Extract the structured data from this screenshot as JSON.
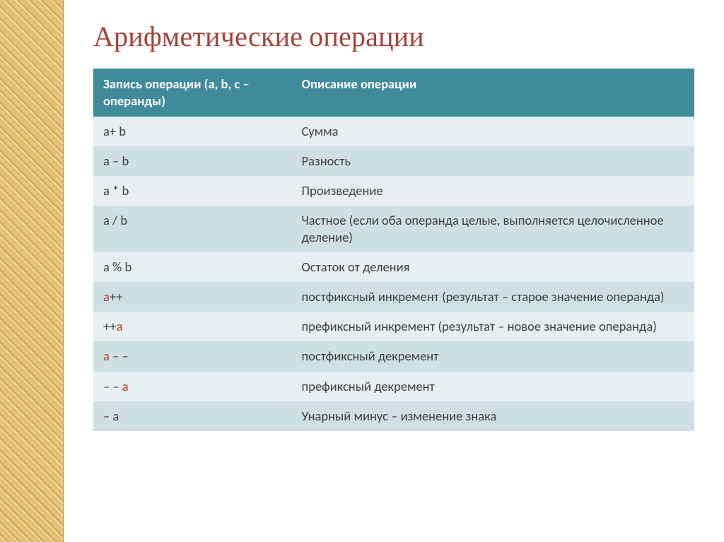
{
  "title": "Арифметические операции",
  "headers": {
    "col1": "Запись операции (a, b, c – операнды)",
    "col2": "Описание операции"
  },
  "rows": [
    {
      "op_plain": "a+ b",
      "desc": "Сумма"
    },
    {
      "op_plain": "a – b",
      "desc": "Разность"
    },
    {
      "op_plain": "a * b",
      "desc": "Произведение"
    },
    {
      "op_plain": "a / b",
      "desc": "Частное (если оба операнда целые, выполняется целочисленное деление)"
    },
    {
      "op_plain": "a % b",
      "desc": "Остаток от деления"
    },
    {
      "op_red_prefix": "a",
      "op_suffix": "++",
      "desc": "постфиксный инкремент (результат – старое значение операнда)"
    },
    {
      "op_prefix": "++",
      "op_red_suffix": "a",
      "desc": "префиксный инкремент (результат – новое значение операнда)"
    },
    {
      "op_red_prefix": "a",
      "op_suffix": " – –",
      "desc": "постфиксный декремент"
    },
    {
      "op_prefix": "– – ",
      "op_red_suffix": "a",
      "desc": "префиксный декремент"
    },
    {
      "op_plain": "– a",
      "desc": "Унарный минус – изменение знака"
    }
  ]
}
